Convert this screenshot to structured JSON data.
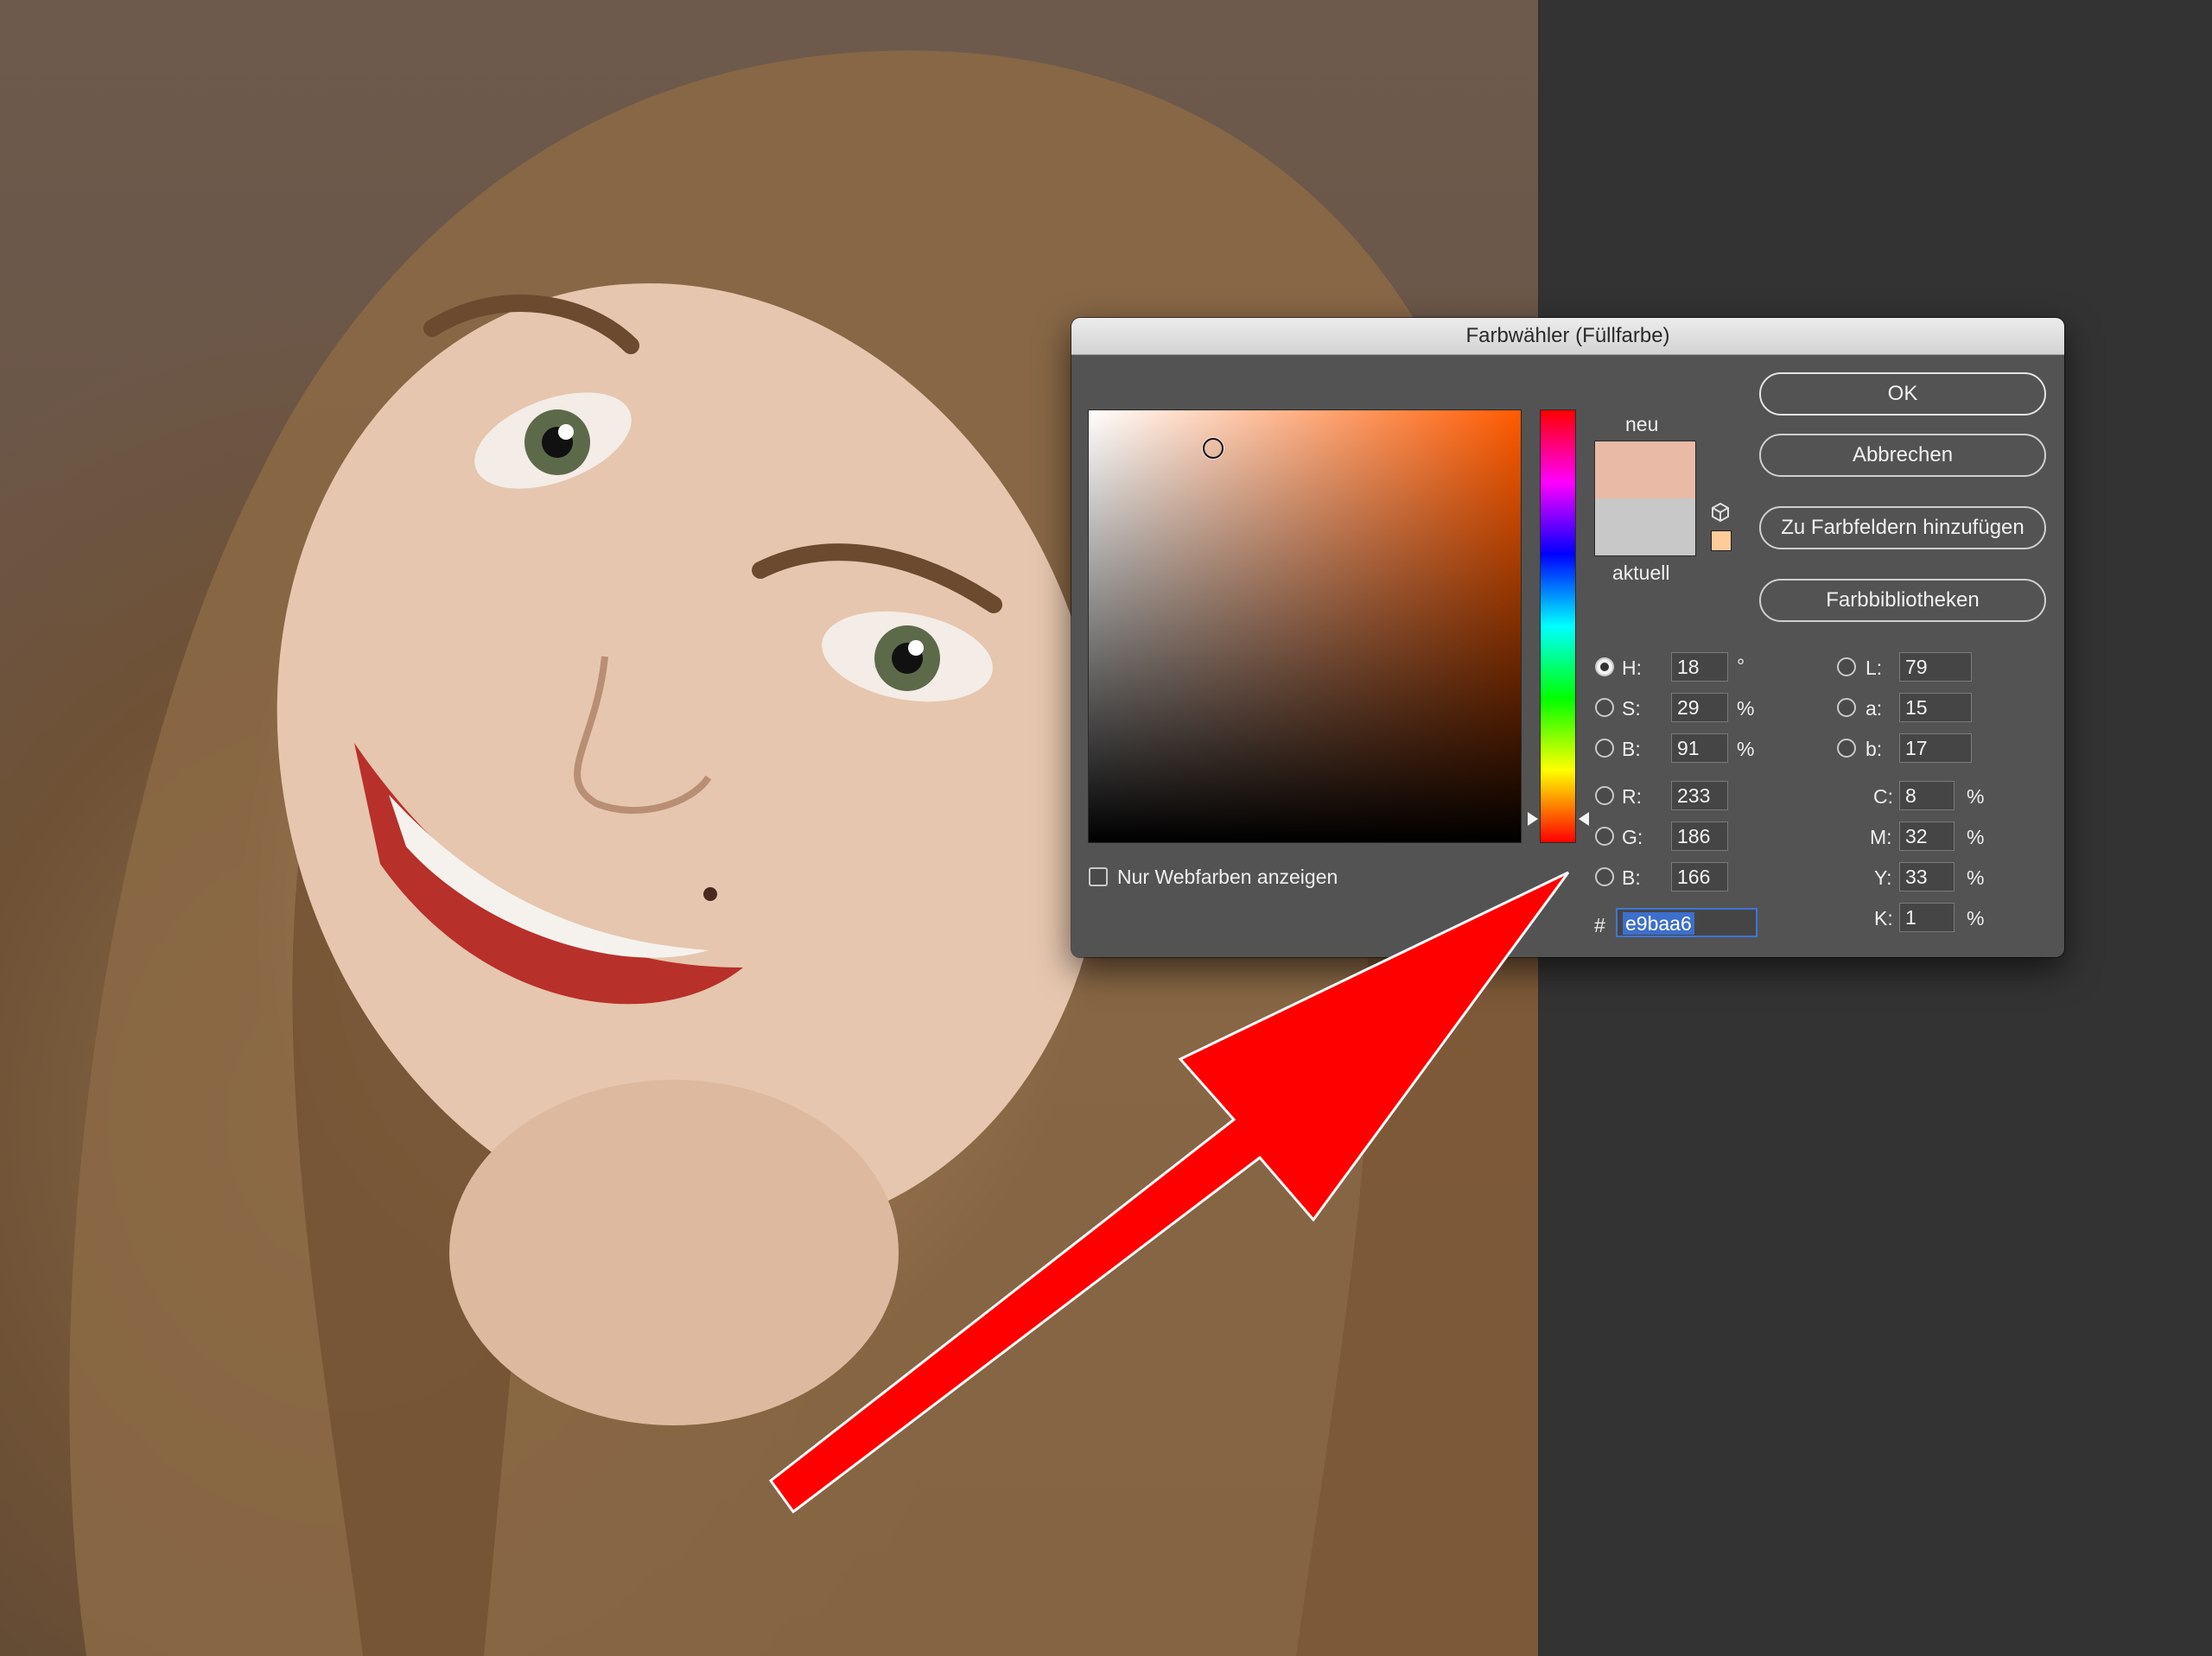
{
  "dialog": {
    "title": "Farbwähler (Füllfarbe)",
    "new_label": "neu",
    "current_label": "aktuell",
    "new_color": "#e9baa6",
    "current_color": "#c8c8c8",
    "web_color_hint": "#ffcc99",
    "web_only_label": "Nur Webfarben anzeigen",
    "buttons": {
      "ok": "OK",
      "cancel": "Abbrechen",
      "add_swatch": "Zu Farbfeldern hinzufügen",
      "libraries": "Farbbibliotheken"
    },
    "hsb": {
      "h": {
        "label": "H:",
        "value": "18",
        "unit": "°"
      },
      "s": {
        "label": "S:",
        "value": "29",
        "unit": "%"
      },
      "b": {
        "label": "B:",
        "value": "91",
        "unit": "%"
      }
    },
    "rgb": {
      "r": {
        "label": "R:",
        "value": "233"
      },
      "g": {
        "label": "G:",
        "value": "186"
      },
      "b": {
        "label": "B:",
        "value": "166"
      }
    },
    "lab": {
      "l": {
        "label": "L:",
        "value": "79"
      },
      "a": {
        "label": "a:",
        "value": "15"
      },
      "b": {
        "label": "b:",
        "value": "17"
      }
    },
    "cmyk": {
      "c": {
        "label": "C:",
        "value": "8",
        "unit": "%"
      },
      "m": {
        "label": "M:",
        "value": "32",
        "unit": "%"
      },
      "y": {
        "label": "Y:",
        "value": "33",
        "unit": "%"
      },
      "k": {
        "label": "K:",
        "value": "1",
        "unit": "%"
      }
    },
    "hex": {
      "label": "#",
      "value": "e9baa6"
    },
    "selected_mode": "H"
  },
  "annotation": {
    "arrow_color": "#ff0000"
  }
}
